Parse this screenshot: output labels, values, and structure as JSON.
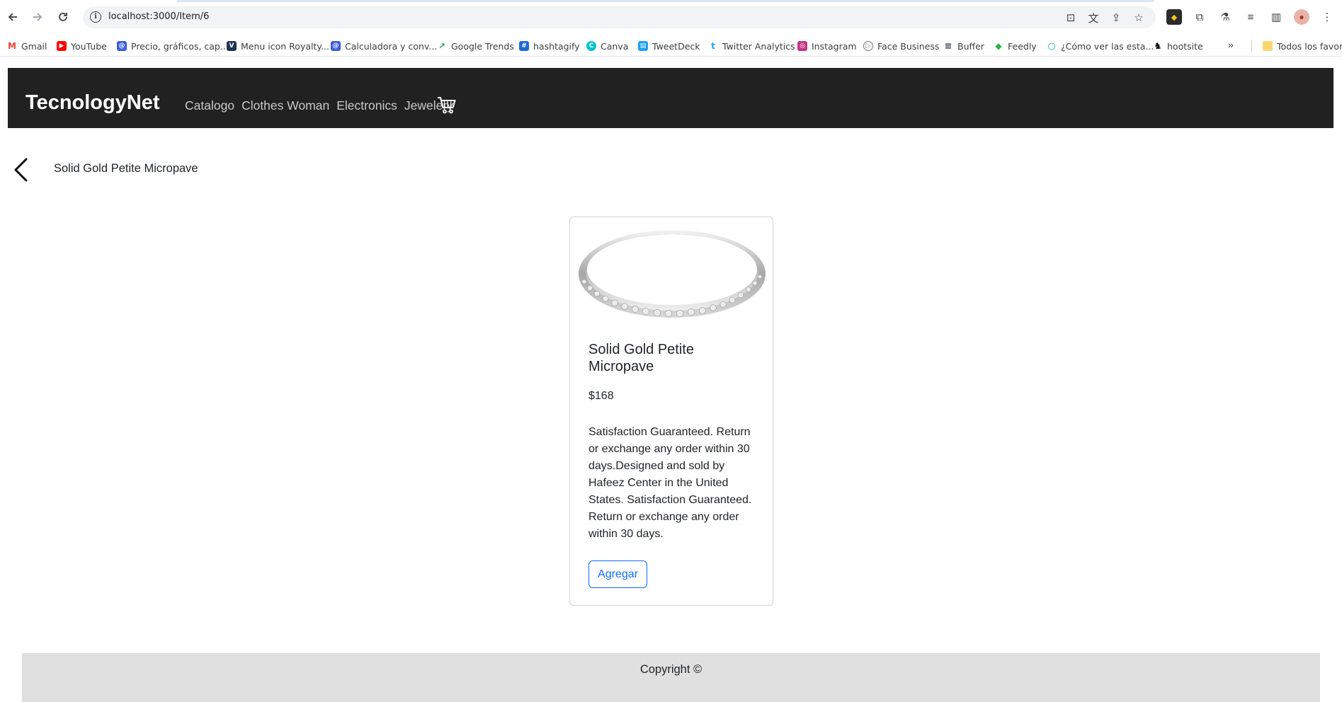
{
  "browser": {
    "url": "localhost:3000/Item/6",
    "back_icon": "arrow-left-icon",
    "forward_icon": "arrow-right-icon",
    "reload_icon": "reload-icon",
    "bookmarks": [
      {
        "label": "Gmail",
        "color": "#ea4335",
        "glyph": "M"
      },
      {
        "label": "YouTube",
        "color": "#ff0000",
        "glyph": "▶"
      },
      {
        "label": "Precio, gráficos, cap...",
        "color": "#3b5bdb",
        "glyph": "@"
      },
      {
        "label": "Menu icon Royalty...",
        "color": "#1d3557",
        "glyph": "V"
      },
      {
        "label": "Calculadora y conv...",
        "color": "#3b5bdb",
        "glyph": "@"
      },
      {
        "label": "Google Trends",
        "color": "#34a853",
        "glyph": "↗"
      },
      {
        "label": "hashtagify",
        "color": "#1e6bd6",
        "glyph": "#"
      },
      {
        "label": "Canva",
        "color": "#00c4cc",
        "glyph": "C"
      },
      {
        "label": "TweetDeck",
        "color": "#1da1f2",
        "glyph": "▤"
      },
      {
        "label": "Twitter Analytics",
        "color": "#1da1f2",
        "glyph": "t"
      },
      {
        "label": "Instagram",
        "color": "#c13584",
        "glyph": "◎"
      },
      {
        "label": "Face Business",
        "color": "#777777",
        "glyph": "▷"
      },
      {
        "label": "Buffer",
        "color": "#323b43",
        "glyph": "≡"
      },
      {
        "label": "Feedly",
        "color": "#2bb24c",
        "glyph": "◆"
      },
      {
        "label": "¿Cómo ver las esta...",
        "color": "#14b8a6",
        "glyph": "○"
      },
      {
        "label": "hootsite",
        "color": "#111111",
        "glyph": "♞"
      }
    ],
    "more_bookmarks": "»",
    "all_bookmarks": "Todos los favoritos"
  },
  "app": {
    "brand": "TecnologyNet",
    "nav": [
      "Catalogo",
      "Clothes Woman",
      "Electronics",
      "Jewelery"
    ],
    "cart_icon": "cart-icon"
  },
  "page": {
    "title": "Solid Gold Petite Micropave",
    "back_icon": "chevron-left-icon"
  },
  "product": {
    "title": "Solid Gold Petite Micropave",
    "price": "$168",
    "description": "Satisfaction Guaranteed. Return or exchange any order within 30 days.Designed and sold by Hafeez Center in the United States. Satisfaction Guaranteed. Return or exchange any order within 30 days.",
    "add_label": "Agregar",
    "image": "ring-image"
  },
  "footer": {
    "copyright": "Copyright ©"
  },
  "colors": {
    "navbar": "#212121",
    "primary": "#0d6efd",
    "footer": "#e0e0e0"
  }
}
